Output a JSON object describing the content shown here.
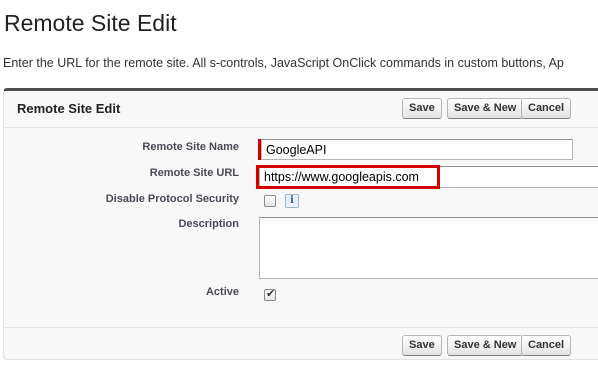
{
  "page": {
    "title": "Remote Site Edit",
    "intro": "Enter the URL for the remote site. All s-controls, JavaScript OnClick commands in custom buttons, Ap"
  },
  "panel": {
    "title": "Remote Site Edit",
    "buttons": {
      "save": "Save",
      "save_new": "Save & New",
      "cancel": "Cancel"
    }
  },
  "form": {
    "name_label": "Remote Site Name",
    "name_value": "GoogleAPI",
    "url_label": "Remote Site URL",
    "url_value": "https://www.googleapis.com",
    "disable_label": "Disable Protocol Security",
    "disable_checked": false,
    "info_icon": "i",
    "description_label": "Description",
    "description_value": "",
    "active_label": "Active",
    "active_checked": true,
    "active_tick": "✔"
  },
  "colors": {
    "highlight": "#d40000",
    "required": "#cc0000",
    "panel_border": "#4f4f4f"
  }
}
